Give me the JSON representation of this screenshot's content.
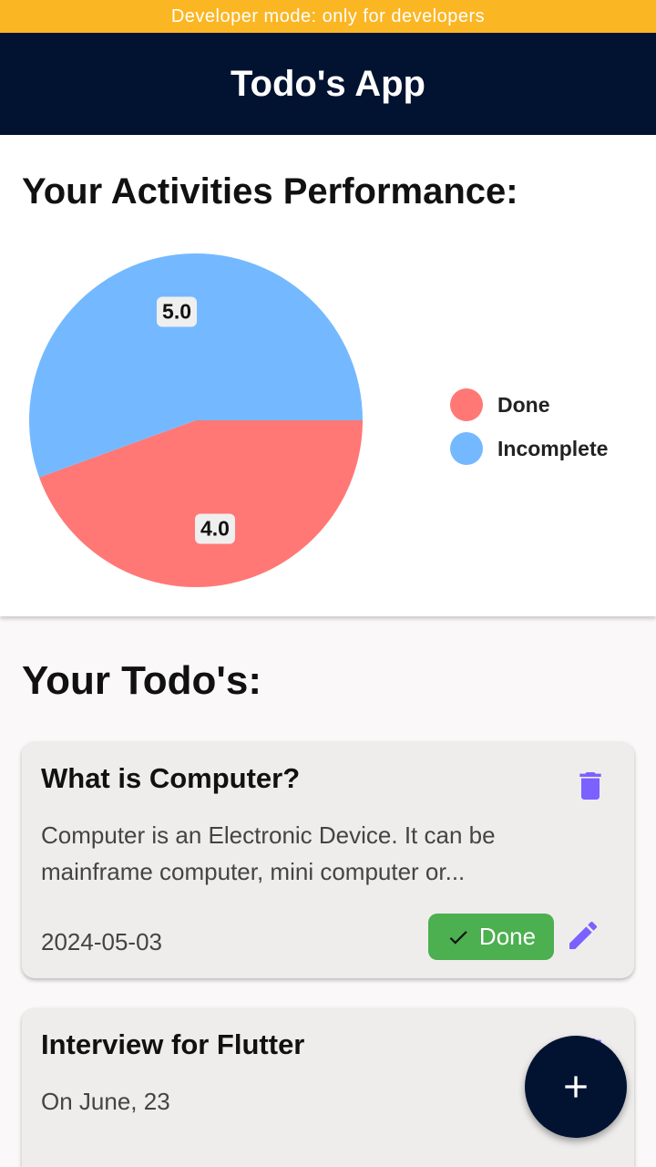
{
  "dev_banner": "Developer mode: only for developers",
  "appbar": {
    "title": "Todo's App"
  },
  "performance": {
    "title": "Your Activities Performance:"
  },
  "chart_data": {
    "type": "pie",
    "slices": [
      {
        "label": "Done",
        "value": 4.0,
        "value_label": "4.0",
        "color": "#ff7875"
      },
      {
        "label": "Incomplete",
        "value": 5.0,
        "value_label": "5.0",
        "color": "#74b9ff"
      }
    ],
    "legend": [
      "Done",
      "Incomplete"
    ],
    "legend_position": "right"
  },
  "todos": {
    "title": "Your Todo's:",
    "items": [
      {
        "title": "What is Computer?",
        "description": "Computer is an Electronic Device. It can be mainframe computer, mini computer or...",
        "date": "2024-05-03",
        "status_label": "Done"
      },
      {
        "title": "Interview for Flutter",
        "description": "On June, 23"
      }
    ]
  },
  "colors": {
    "accent": "#7b61ff",
    "appbar": "#011331",
    "banner": "#fbb623",
    "done": "#4caf50"
  },
  "icons": {
    "delete": "trash-icon",
    "edit": "pencil-icon",
    "done": "check-icon",
    "fab": "plus-icon"
  }
}
